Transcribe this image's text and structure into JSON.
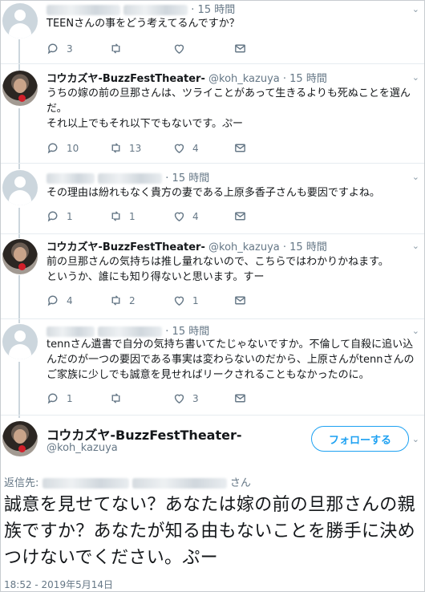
{
  "tweets": [
    {
      "time": "· 15 時間",
      "text": "TEENさんの事をどう考えてるんですか？",
      "reply_count": "3",
      "retweet_count": "",
      "like_count": ""
    },
    {
      "name": "コウカズヤ-BuzzFestTheater-",
      "handle": "@koh_kazuya",
      "time": "· 15 時間",
      "text": "うちの嫁の前の旦那さんは、ツライことがあって生きるよりも死ぬことを選んだ。\nそれ以上でもそれ以下でもないです。ぷー",
      "reply_count": "10",
      "retweet_count": "13",
      "like_count": "4"
    },
    {
      "time": "· 15 時間",
      "text": "その理由は紛れもなく貴方の妻である上原多香子さんも要因ですよね。",
      "reply_count": "1",
      "retweet_count": "1",
      "like_count": "4"
    },
    {
      "name": "コウカズヤ-BuzzFestTheater-",
      "handle": "@koh_kazuya",
      "time": "· 15 時間",
      "text": "前の旦那さんの気持ちは推し量れないので、こちらではわかりかねます。\nというか、誰にも知り得ないと思います。すー",
      "reply_count": "4",
      "retweet_count": "2",
      "like_count": "1"
    },
    {
      "time": "· 15 時間",
      "text": "tennさん遺書で自分の気持ち書いてたじゃないですか。不倫して自殺に追い込んだのが一つの要因である事実は変わらないのだから、上原さんがtennさんのご家族に少しでも誠意を見せればリークされることもなかったのに。",
      "reply_count": "1",
      "retweet_count": "",
      "like_count": "3"
    }
  ],
  "main_tweet": {
    "name": "コウカズヤ-BuzzFestTheater-",
    "handle": "@koh_kazuya",
    "follow_label": "フォローする",
    "reply_to_label": "返信先:",
    "reply_to_suffix": "さん",
    "text": "誠意を見せてない？あなたは嫁の前の旦那さんの親族ですか？あなたが知る由もないことを勝手に決めつけないでください。ぷー",
    "timestamp": "18:52 - 2019年5月14日"
  },
  "colors": {
    "accent": "#1da1f2",
    "muted": "#657786",
    "thread": "#ccd6dd"
  },
  "icons": [
    "default-avatar-icon",
    "reply-icon",
    "retweet-icon",
    "like-icon",
    "dm-icon",
    "chevron-down-icon"
  ]
}
